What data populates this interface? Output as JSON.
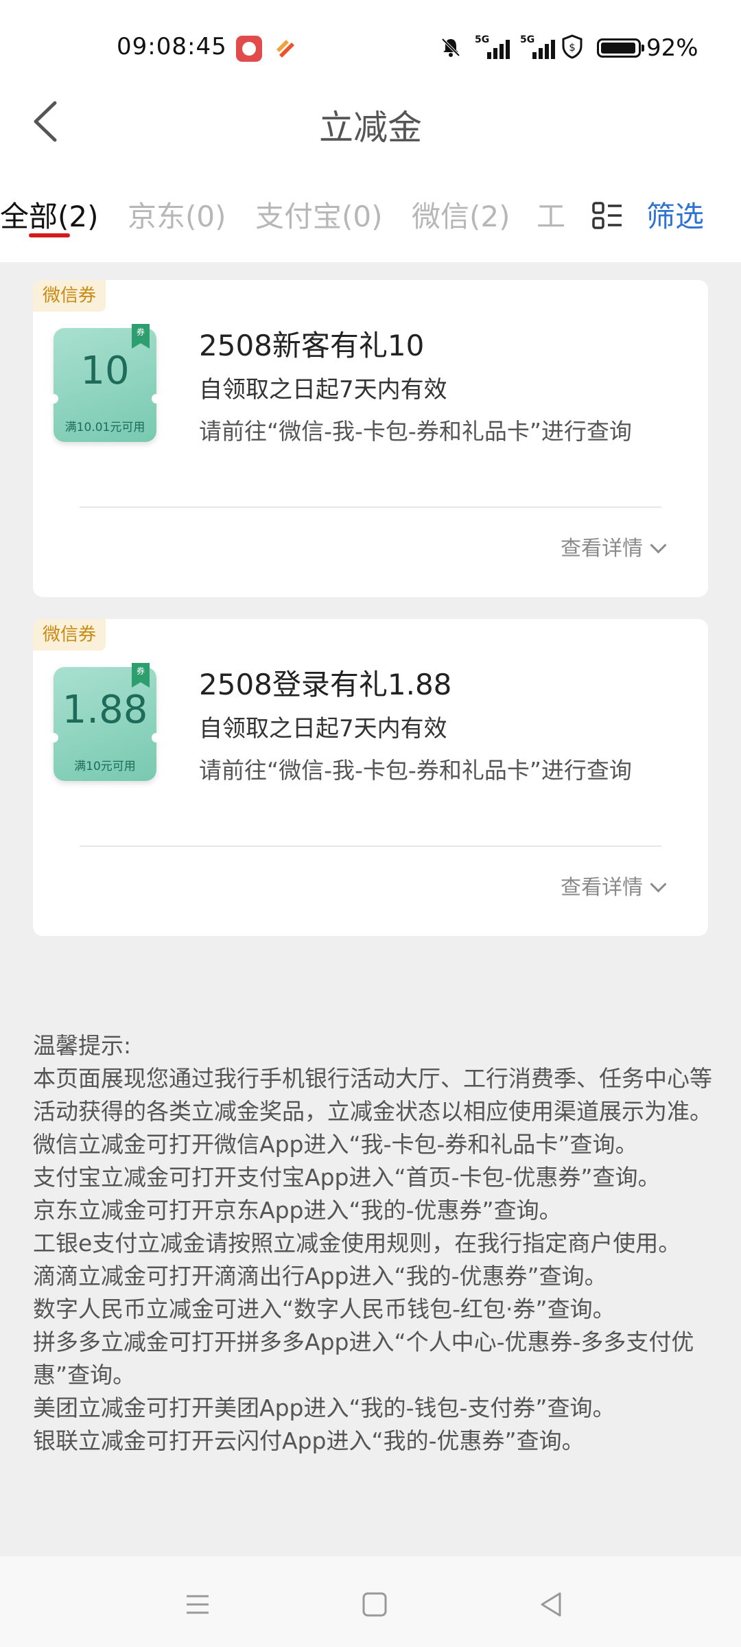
{
  "status_bar": {
    "time": "09:08:45",
    "signal1_label": "5G",
    "signal2_label": "5G",
    "battery": "92%",
    "icons": [
      "app-notification-icon",
      "app-notification-icon-2",
      "mute-bell-icon",
      "signal-icon",
      "signal-icon",
      "shield-icon",
      "battery-icon"
    ]
  },
  "header": {
    "title": "立减金",
    "back_icon": "chevron-left-icon"
  },
  "tabs": [
    {
      "label": "全部(2)",
      "active": true
    },
    {
      "label": "京东(0)",
      "active": false
    },
    {
      "label": "支付宝(0)",
      "active": false
    },
    {
      "label": "微信(2)",
      "active": false
    },
    {
      "label": "工",
      "active": false
    }
  ],
  "filter_label": "筛选",
  "coupons": [
    {
      "tag": "微信券",
      "badge": "券",
      "amount": "10",
      "condition": "满10.01元可用",
      "title": "2508新客有礼10",
      "validity": "自领取之日起7天内有效",
      "hint": "请前往“微信-我-卡包-券和礼品卡”进行查询",
      "detail_label": "查看详情"
    },
    {
      "tag": "微信券",
      "badge": "券",
      "amount": "1.88",
      "condition": "满10元可用",
      "title": "2508登录有礼1.88",
      "validity": "自领取之日起7天内有效",
      "hint": "请前往“微信-我-卡包-券和礼品卡”进行查询",
      "detail_label": "查看详情"
    }
  ],
  "tips": {
    "heading": "温馨提示:",
    "lines": [
      "本页面展现您通过我行手机银行活动大厅、工行消费季、任务中心等活动获得的各类立减金奖品，立减金状态以相应使用渠道展示为准。",
      "微信立减金可打开微信App进入“我-卡包-券和礼品卡”查询。",
      "支付宝立减金可打开支付宝App进入“首页-卡包-优惠券”查询。",
      "京东立减金可打开京东App进入“我的-优惠券”查询。",
      "工银e支付立减金请按照立减金使用规则，在我行指定商户使用。",
      "滴滴立减金可打开滴滴出行App进入“我的-优惠券”查询。",
      "数字人民币立减金可进入“数字人民币钱包-红包·券”查询。",
      "拼多多立减金可打开拼多多App进入“个人中心-优惠券-多多支付优惠”查询。",
      "美团立减金可打开美团App进入“我的-钱包-支付券”查询。",
      "银联立减金可打开云闪付App进入“我的-优惠券”查询。"
    ]
  },
  "colors": {
    "accent_red": "#d41a1a",
    "filter_blue": "#2f74d0",
    "tag_bg": "#fbf1da",
    "tag_text": "#c98a14",
    "ticket_green": "#78c9b0"
  }
}
